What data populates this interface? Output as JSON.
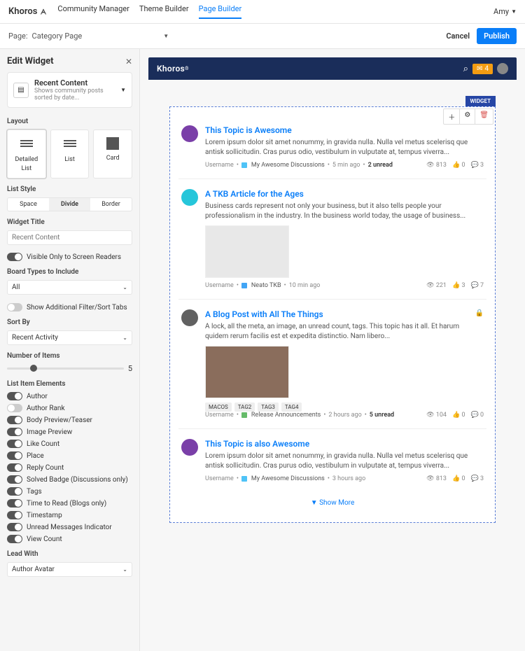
{
  "top": {
    "brand": "Khoros",
    "nav": [
      "Community Manager",
      "Theme Builder",
      "Page Builder"
    ],
    "active": 2,
    "user": "Amy"
  },
  "sub": {
    "pageLabel": "Page:",
    "pageName": "Category Page",
    "cancel": "Cancel",
    "publish": "Publish"
  },
  "panel": {
    "title": "Edit Widget",
    "widget": {
      "title": "Recent Content",
      "desc": "Shows community posts sorted by date..."
    },
    "layoutLabel": "Layout",
    "layouts": [
      "Detailed List",
      "List",
      "Card"
    ],
    "layoutActive": 0,
    "listStyleLabel": "List Style",
    "listStyles": [
      "Space",
      "Divide",
      "Border"
    ],
    "listStyleActive": 1,
    "widgetTitleLabel": "Widget Title",
    "widgetTitlePh": "Recent Content",
    "visibleSR": "Visible Only to Screen Readers",
    "boardTypesLabel": "Board Types to Include",
    "boardTypes": "All",
    "showFilter": "Show Additional Filter/Sort Tabs",
    "sortByLabel": "Sort By",
    "sortBy": "Recent Activity",
    "numberLabel": "Number of Items",
    "numberVal": "5",
    "elementsLabel": "List Item Elements",
    "elements": [
      {
        "label": "Author",
        "on": true
      },
      {
        "label": "Author Rank",
        "on": false
      },
      {
        "label": "Body Preview/Teaser",
        "on": true
      },
      {
        "label": "Image Preview",
        "on": true
      },
      {
        "label": "Like Count",
        "on": true
      },
      {
        "label": "Place",
        "on": true
      },
      {
        "label": "Reply Count",
        "on": true
      },
      {
        "label": "Solved Badge (Discussions only)",
        "on": true
      },
      {
        "label": "Tags",
        "on": true
      },
      {
        "label": "Time to Read (Blogs only)",
        "on": true
      },
      {
        "label": "Timestamp",
        "on": true
      },
      {
        "label": "Unread Messages Indicator",
        "on": true
      },
      {
        "label": "View Count",
        "on": true
      }
    ],
    "leadWithLabel": "Lead With",
    "leadWith": "Author Avatar"
  },
  "preview": {
    "logo": "Khoros",
    "msgCount": "4",
    "widgetLabel": "WIDGET",
    "showMore": "Show More",
    "posts": [
      {
        "avColor": "#7a3fa8",
        "title": "This Topic is Awesome",
        "text": "Lorem ipsum dolor sit amet nonummy, in gravida nulla. Nulla vel metus scelerisq que antisk sollicitudin. Cras purus odio, vestibulum in vulputate at, tempus viverra...",
        "user": "Username",
        "boardColor": "#4fc3f7",
        "board": "My Awesome Discussions",
        "time": "5 min ago",
        "unread": "2 unread",
        "views": "813",
        "likes": "0",
        "replies": "3"
      },
      {
        "avColor": "#26c6da",
        "title": "A TKB Article for the Ages",
        "text": "Business cards represent not only your business, but it also tells people your professionalism in the industry. In the business world today, the usage of business...",
        "hasImg": true,
        "imgColor": "#e8e8e8",
        "user": "Username",
        "boardColor": "#42a5f5",
        "board": "Neato TKB",
        "time": "10 min ago",
        "views": "221",
        "likes": "3",
        "replies": "7"
      },
      {
        "avColor": "#616161",
        "title": "A Blog Post with All The Things",
        "locked": true,
        "text": "A lock, all the meta, an image, an unread count, tags. This topic has it all. Et harum quidem rerum facilis est et expedita distinctio. Nam libero...",
        "hasImg": true,
        "imgColor": "#8a6d5c",
        "user": "Username",
        "boardColor": "#66bb6a",
        "board": "Release Announcements",
        "time": "2 hours ago",
        "unread": "5 unread",
        "tags": [
          "MACOS",
          "TAG2",
          "TAG3",
          "TAG4"
        ],
        "views": "104",
        "likes": "0",
        "replies": "0"
      },
      {
        "avColor": "#7a3fa8",
        "title": "This Topic is also Awesome",
        "text": "Lorem ipsum dolor sit amet nonummy, in gravida nulla. Nulla vel metus scelerisq que antisk sollicitudin. Cras purus odio, vestibulum in vulputate at, tempus viverra...",
        "user": "Username",
        "boardColor": "#4fc3f7",
        "board": "My Awesome Discussions",
        "time": "3 hours ago",
        "views": "813",
        "likes": "0",
        "replies": "3"
      }
    ]
  }
}
